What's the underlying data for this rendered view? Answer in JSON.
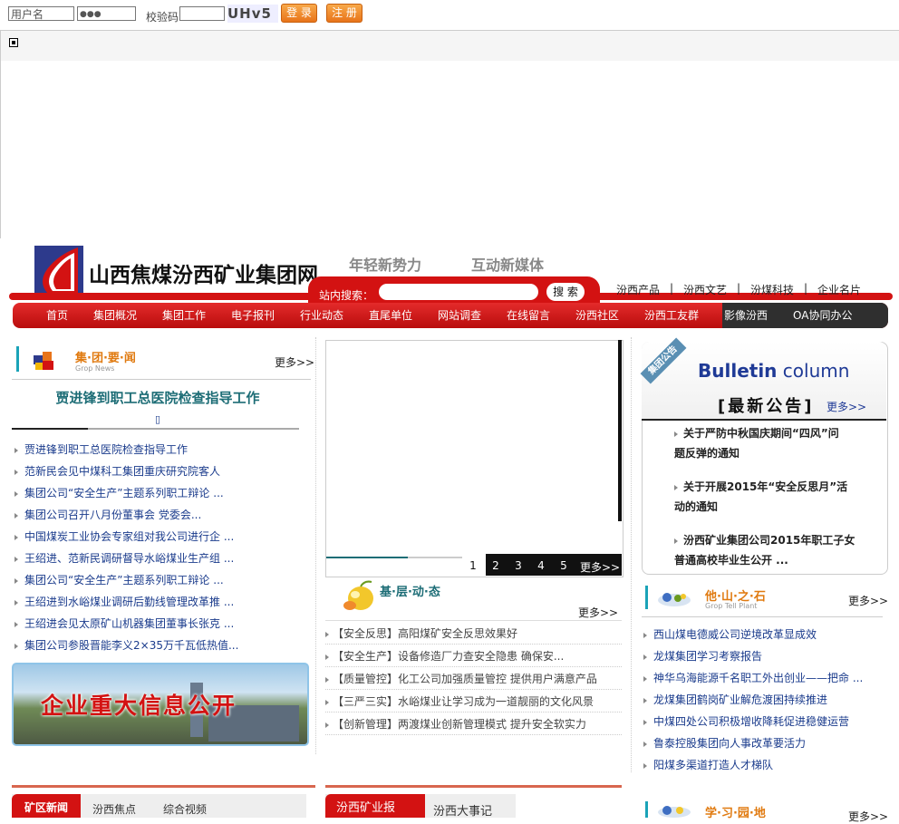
{
  "login": {
    "username_value": "用户名",
    "password_value": "●●●",
    "captcha_label": "校验码",
    "captcha_image_text": "UHv5",
    "login_button": "登 录",
    "register_button": "注 册"
  },
  "site": {
    "title": "山西焦煤汾西矿业集团网",
    "slogan1": "年轻新势力",
    "slogan2": "互动新媒体",
    "search_label": "站内搜索：",
    "search_button": "搜 索",
    "top_links": [
      "汾西产品",
      "汾西文艺",
      "汾煤科技",
      "企业名片"
    ],
    "separator": "|"
  },
  "nav": [
    "首页",
    "集团概况",
    "集团工作",
    "电子报刊",
    "行业动态",
    "直尾单位",
    "网站调查",
    "在线留言",
    "汾西社区",
    "汾西工友群",
    "影像汾西",
    "OA协同办公"
  ],
  "group_news": {
    "title": "集·团·要·闻",
    "subtitle": "Grop News",
    "more": "更多>>",
    "headline": "贾进锋到职工总医院检查指导工作",
    "headline_mark": "▯",
    "items": [
      "贾进锋到职工总医院检查指导工作",
      "范新民会见中煤科工集团重庆研究院客人",
      "集团公司“安全生产”主题系列职工辩论 ...",
      "集团公司召开八月份董事会  党委会...",
      "中国煤炭工业协会专家组对我公司进行企 ...",
      "王绍进、范新民调研督导水峪煤业生产组 ...",
      "集团公司“安全生产”主题系列职工辩论 ...",
      "王绍进到水峪煤业调研后勤线管理改革推 ...",
      "王绍进会见太原矿山机器集团董事长张克 ...",
      "集团公司参股晋能李义2×35万千瓦低热值..."
    ],
    "banner_text": "企业重大信息公开"
  },
  "slider": {
    "pages": [
      "1",
      "2",
      "3",
      "4",
      "5"
    ],
    "more": "更多>>"
  },
  "grassroots": {
    "title": "基·层·动·态",
    "more": "更多>>",
    "items": [
      {
        "tag": "【安全反思】",
        "text": "高阳煤矿安全反思效果好"
      },
      {
        "tag": "【安全生产】",
        "text": "设备修造厂力查安全隐患 确保安..."
      },
      {
        "tag": "【质量管控】",
        "text": "化工公司加强质量管控 提供用户满意产品"
      },
      {
        "tag": "【三严三实】",
        "text": "水峪煤业让学习成为一道靓丽的文化风景"
      },
      {
        "tag": "【创新管理】",
        "text": "两渡煤业创新管理模式 提升安全软实力"
      }
    ]
  },
  "bulletin": {
    "ribbon": "集团公告",
    "en_title_bold": "Bulletin",
    "en_title_light": " column",
    "cn_title": "[最新公告]",
    "more": "更多>>",
    "items": [
      [
        "关于严防中秋国庆期间“四风”问",
        "题反弹的通知"
      ],
      [
        "关于开展2015年“安全反思月”活",
        "动的通知"
      ],
      [
        "汾西矿业集团公司2015年职工子女",
        "普通高校毕业生公开 ..."
      ]
    ]
  },
  "other_stones": {
    "title": "他·山·之·石",
    "subtitle": "Grop Tell Plant",
    "more": "更多>>",
    "items": [
      "西山煤电德威公司逆境改革显成效",
      "龙煤集团学习考察报告",
      "神华乌海能源千名职工外出创业——把命 ...",
      "龙煤集团鹤岗矿业解危渡困持续推进",
      "中煤四处公司积极增收降耗促进稳健运营",
      "鲁泰控股集团向人事改革要活力",
      "阳煤多渠道打造人才梯队"
    ]
  },
  "bottom_tabs_left": [
    "矿区新闻",
    "汾西焦点",
    "综合视频"
  ],
  "bottom_tabs_mid": [
    "汾西矿业报",
    "汾西大事记"
  ],
  "study": {
    "title": "学·习·园·地",
    "more": "更多>>"
  },
  "colors": {
    "red": "#d31212",
    "orange": "#e8741a",
    "link": "#1a3b8c",
    "teal": "#1d6d76"
  }
}
